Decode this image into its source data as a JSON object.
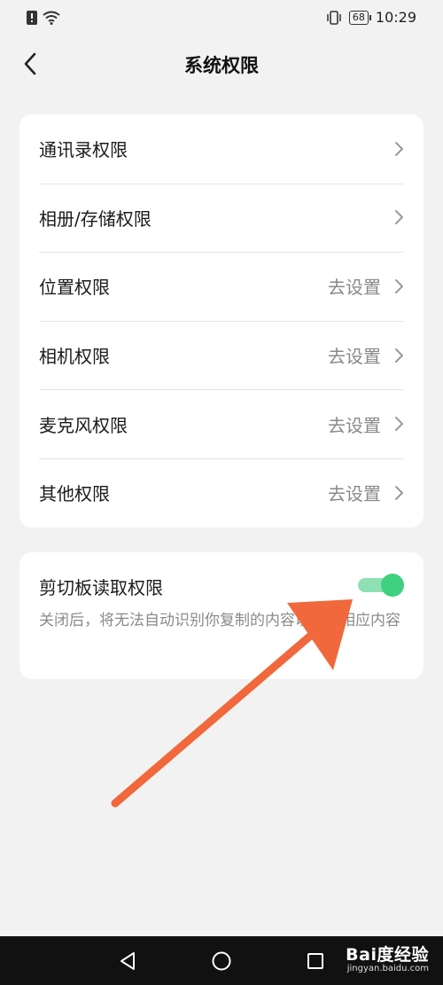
{
  "status_bar": {
    "time": "10:29",
    "battery": "68"
  },
  "header": {
    "title": "系统权限"
  },
  "permissions": [
    {
      "label": "通讯录权限",
      "value": ""
    },
    {
      "label": "相册/存储权限",
      "value": ""
    },
    {
      "label": "位置权限",
      "value": "去设置"
    },
    {
      "label": "相机权限",
      "value": "去设置"
    },
    {
      "label": "麦克风权限",
      "value": "去设置"
    },
    {
      "label": "其他权限",
      "value": "去设置"
    }
  ],
  "clipboard": {
    "label": "剪切板读取权限",
    "description": "关闭后，将无法自动识别你复制的内容以展示相应内容",
    "enabled": true,
    "toggle_color": "#3ecf7f"
  },
  "annotation": {
    "arrow_color": "#f0683c"
  },
  "watermark": {
    "logo": "Bai度经验",
    "url": "jingyan.baidu.com"
  }
}
